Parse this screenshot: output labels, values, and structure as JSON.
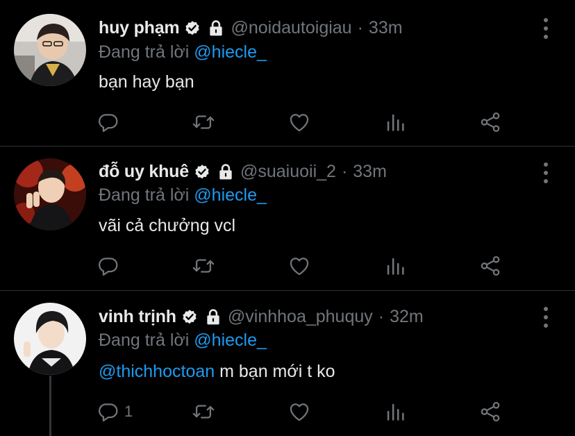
{
  "tweets": [
    {
      "name": "huy phạm",
      "handle": "@noidautoigiau",
      "dot": "·",
      "time": "33m",
      "replying_prefix": "Đang trả lời",
      "replying_to": "@hiecle_",
      "text": "bạn hay bạn",
      "mention": "",
      "reply_count": ""
    },
    {
      "name": "đỗ uy khuê",
      "handle": "@suaiuoii_2",
      "dot": "·",
      "time": "33m",
      "replying_prefix": "Đang trả lời",
      "replying_to": "@hiecle_",
      "text": "vãi cả chưởng vcl",
      "mention": "",
      "reply_count": ""
    },
    {
      "name": "vinh trịnh",
      "handle": "@vinhhoa_phuquy",
      "dot": "·",
      "time": "32m",
      "replying_prefix": "Đang trả lời",
      "replying_to": "@hiecle_",
      "text": "m bạn mới t ko",
      "mention": "@thichhoctoan",
      "reply_count": "1"
    }
  ],
  "colors": {
    "background": "#000000",
    "accent": "#1d9bf0",
    "muted": "#71767b",
    "text": "#e7e9ea"
  },
  "icons": [
    "verified-badge-icon",
    "lock-icon",
    "more-icon",
    "reply-icon",
    "retweet-icon",
    "like-icon",
    "analytics-icon",
    "share-icon"
  ]
}
